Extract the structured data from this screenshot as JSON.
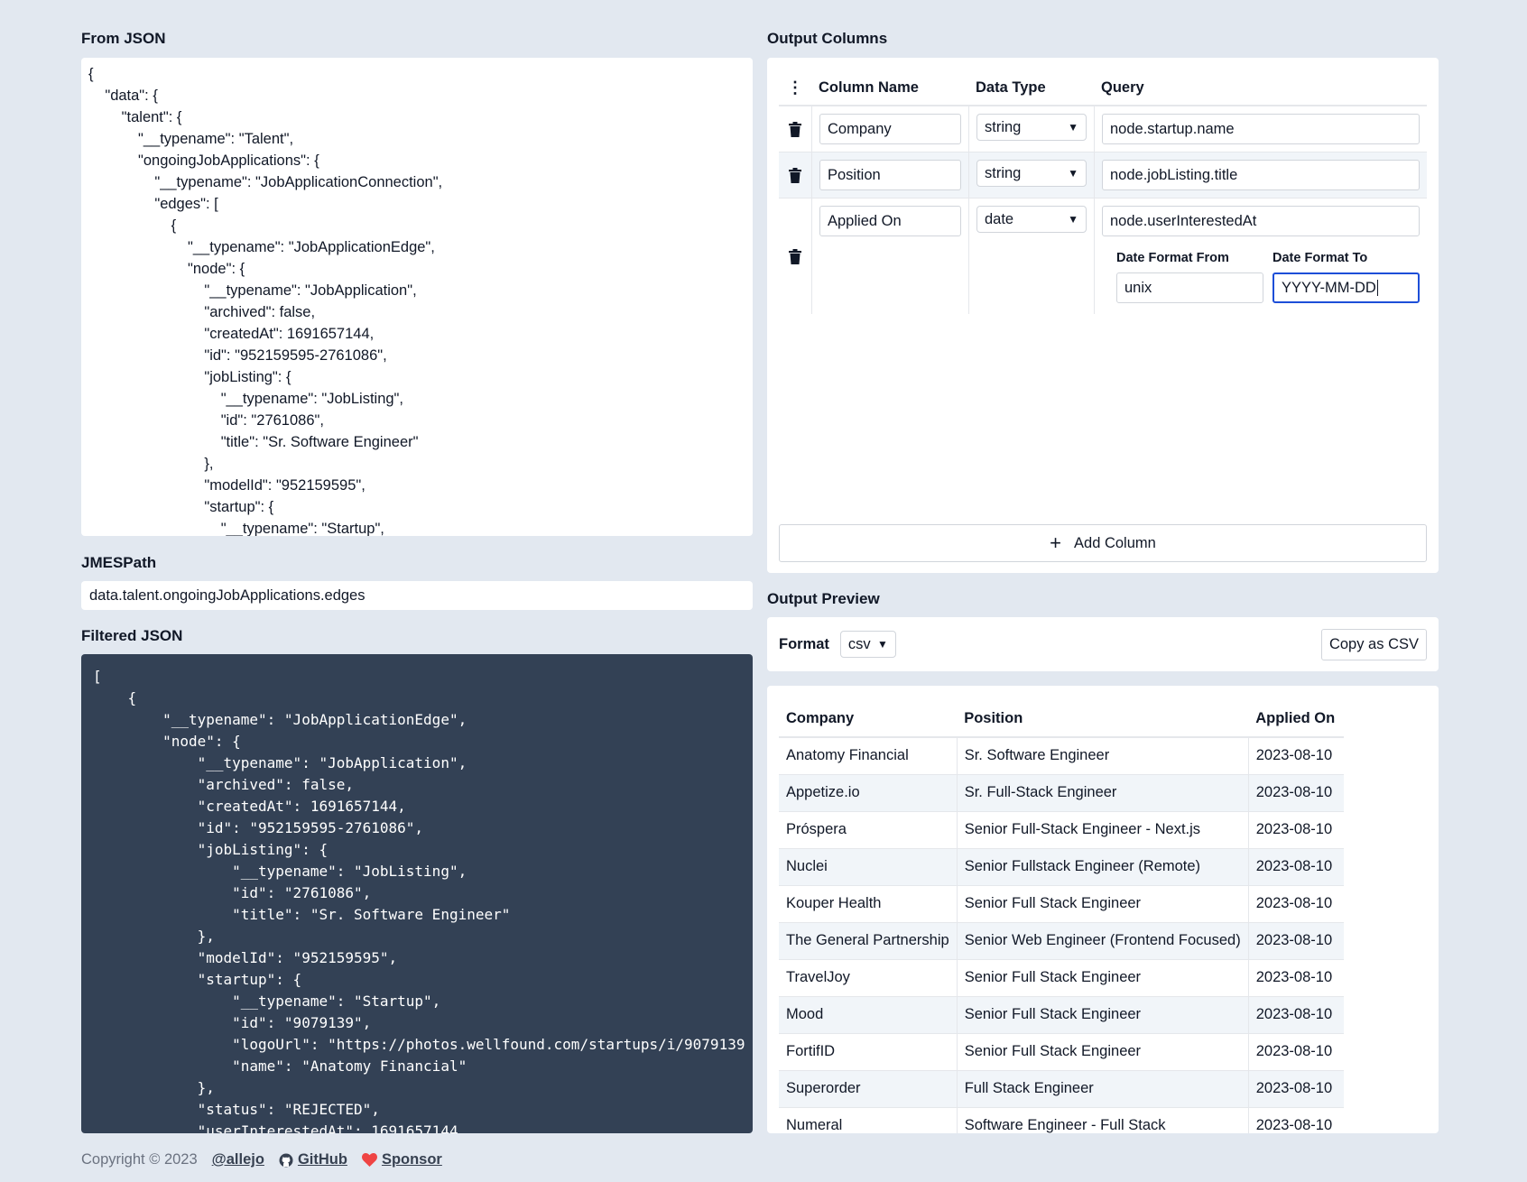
{
  "from_json": {
    "title": "From JSON",
    "content": "{\n    \"data\": {\n        \"talent\": {\n            \"__typename\": \"Talent\",\n            \"ongoingJobApplications\": {\n                \"__typename\": \"JobApplicationConnection\",\n                \"edges\": [\n                    {\n                        \"__typename\": \"JobApplicationEdge\",\n                        \"node\": {\n                            \"__typename\": \"JobApplication\",\n                            \"archived\": false,\n                            \"createdAt\": 1691657144,\n                            \"id\": \"952159595-2761086\",\n                            \"jobListing\": {\n                                \"__typename\": \"JobListing\",\n                                \"id\": \"2761086\",\n                                \"title\": \"Sr. Software Engineer\"\n                            },\n                            \"modelId\": \"952159595\",\n                            \"startup\": {\n                                \"__typename\": \"Startup\","
  },
  "jmespath": {
    "title": "JMESPath",
    "value": "data.talent.ongoingJobApplications.edges"
  },
  "filtered_json": {
    "title": "Filtered JSON",
    "content": "[\n    {\n        \"__typename\": \"JobApplicationEdge\",\n        \"node\": {\n            \"__typename\": \"JobApplication\",\n            \"archived\": false,\n            \"createdAt\": 1691657144,\n            \"id\": \"952159595-2761086\",\n            \"jobListing\": {\n                \"__typename\": \"JobListing\",\n                \"id\": \"2761086\",\n                \"title\": \"Sr. Software Engineer\"\n            },\n            \"modelId\": \"952159595\",\n            \"startup\": {\n                \"__typename\": \"Startup\",\n                \"id\": \"9079139\",\n                \"logoUrl\": \"https://photos.wellfound.com/startups/i/9079139\n                \"name\": \"Anatomy Financial\"\n            },\n            \"status\": \"REJECTED\",\n            \"userInterestedAt\": 1691657144,"
  },
  "output_columns": {
    "title": "Output Columns",
    "headers": {
      "name": "Column Name",
      "type": "Data Type",
      "query": "Query"
    },
    "columns": [
      {
        "name": "Company",
        "type": "string",
        "query": "node.startup.name"
      },
      {
        "name": "Position",
        "type": "string",
        "query": "node.jobListing.title"
      },
      {
        "name": "Applied On",
        "type": "date",
        "query": "node.userInterestedAt",
        "date_format_from_label": "Date Format From",
        "date_format_from": "unix",
        "date_format_to_label": "Date Format To",
        "date_format_to": "YYYY-MM-DD"
      }
    ],
    "add_column_label": "Add Column"
  },
  "output_preview": {
    "title": "Output Preview",
    "format_label": "Format",
    "format_value": "csv",
    "copy_button": "Copy as CSV",
    "headers": [
      "Company",
      "Position",
      "Applied On"
    ],
    "rows": [
      [
        "Anatomy Financial",
        "Sr. Software Engineer",
        "2023-08-10"
      ],
      [
        "Appetize.io",
        "Sr. Full-Stack Engineer",
        "2023-08-10"
      ],
      [
        "Próspera",
        "Senior Full-Stack Engineer - Next.js",
        "2023-08-10"
      ],
      [
        "Nuclei",
        "Senior Fullstack Engineer (Remote)",
        "2023-08-10"
      ],
      [
        "Kouper Health",
        "Senior Full Stack Engineer",
        "2023-08-10"
      ],
      [
        "The General Partnership",
        "Senior Web Engineer (Frontend Focused)",
        "2023-08-10"
      ],
      [
        "TravelJoy",
        "Senior Full Stack Engineer",
        "2023-08-10"
      ],
      [
        "Mood",
        "Senior Full Stack Engineer",
        "2023-08-10"
      ],
      [
        "FortifID",
        "Senior Full Stack Engineer",
        "2023-08-10"
      ],
      [
        "Superorder",
        "Full Stack Engineer",
        "2023-08-10"
      ],
      [
        "Numeral",
        "Software Engineer - Full Stack",
        "2023-08-10"
      ]
    ]
  },
  "footer": {
    "copyright": "Copyright © 2023",
    "handle": "@allejo",
    "github": "GitHub",
    "sponsor": "Sponsor"
  },
  "colors": {
    "background": "#e2e8f0",
    "code_bg": "#334155",
    "focus_ring": "#1d4ed8",
    "heart": "#ef4444"
  }
}
